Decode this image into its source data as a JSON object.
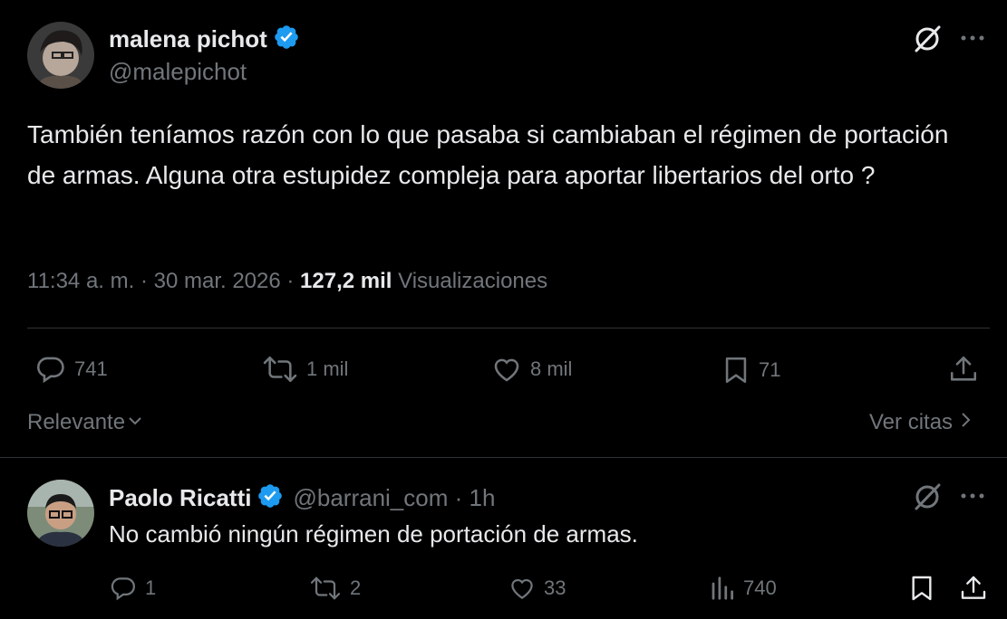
{
  "tweet": {
    "author_name": "malena pichot",
    "author_handle": "@malepichot",
    "text": "También teníamos razón con lo que pasaba si cambiaban el régimen de portación de armas. Alguna otra estupidez compleja para aportar libertarios del orto ?",
    "timestamp": "11:34 a. m. · 30 mar. 2026 · ",
    "views_count": "127,2 mil",
    "views_label": "Visualizaciones",
    "actions": {
      "replies": "741",
      "retweets": "1 mil",
      "likes": "8 mil",
      "bookmarks": "71"
    }
  },
  "filter": {
    "sort_label": "Relevante",
    "quotes_label": "Ver citas"
  },
  "reply": {
    "author_name": "Paolo Ricatti",
    "author_handle": "@barrani_com · 1h",
    "text": "No cambió ningún régimen de portación de armas.",
    "actions": {
      "replies": "1",
      "retweets": "2",
      "likes": "33",
      "views": "740"
    }
  },
  "colors": {
    "background": "#000000",
    "text_primary": "#e7e9ea",
    "text_secondary": "#71767b",
    "verified_blue": "#1d9bf0",
    "divider": "#2f3336"
  },
  "icons": [
    "verified-badge-icon",
    "grok-icon",
    "more-icon",
    "reply-icon",
    "retweet-icon",
    "like-icon",
    "bookmark-icon",
    "share-icon",
    "views-icon",
    "chevron-down-icon",
    "chevron-right-icon"
  ]
}
